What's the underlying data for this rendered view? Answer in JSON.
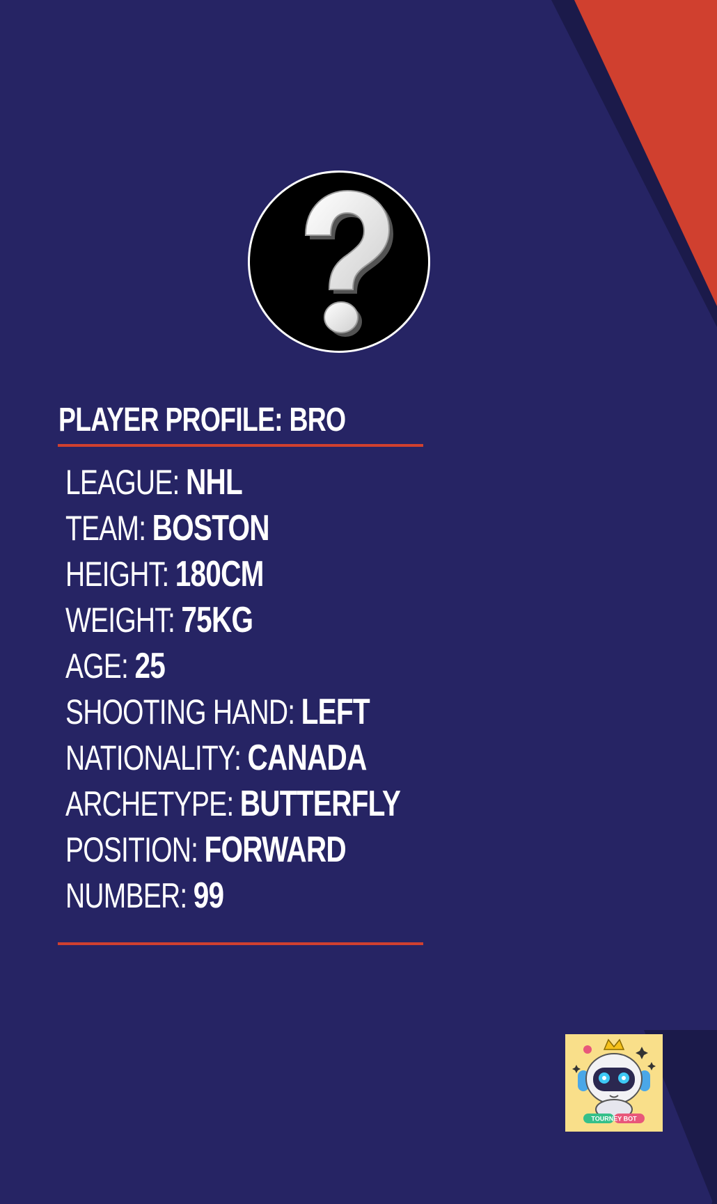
{
  "profile": {
    "title": "PLAYER PROFILE: BRO",
    "stats": [
      {
        "label": "LEAGUE:",
        "value": "NHL"
      },
      {
        "label": "TEAM:",
        "value": "BOSTON"
      },
      {
        "label": "HEIGHT:",
        "value": "180CM"
      },
      {
        "label": "WEIGHT:",
        "value": "75KG"
      },
      {
        "label": "AGE:",
        "value": "25"
      },
      {
        "label": "SHOOTING HAND:",
        "value": "LEFT"
      },
      {
        "label": "NATIONALITY:",
        "value": "CANADA"
      },
      {
        "label": "ARCHETYPE:",
        "value": "BUTTERFLY"
      },
      {
        "label": "POSITION:",
        "value": "FORWARD"
      },
      {
        "label": "NUMBER:",
        "value": "99"
      }
    ]
  },
  "avatar": {
    "icon": "question-mark-icon"
  },
  "logo": {
    "text": "TOURNEY BOT",
    "icon": "robot-mascot-icon"
  },
  "colors": {
    "background": "#262464",
    "accent": "#d0402f",
    "stripe_dark": "#1b1a4a",
    "text": "#ffffff",
    "logo_bg": "#f9df8a"
  }
}
